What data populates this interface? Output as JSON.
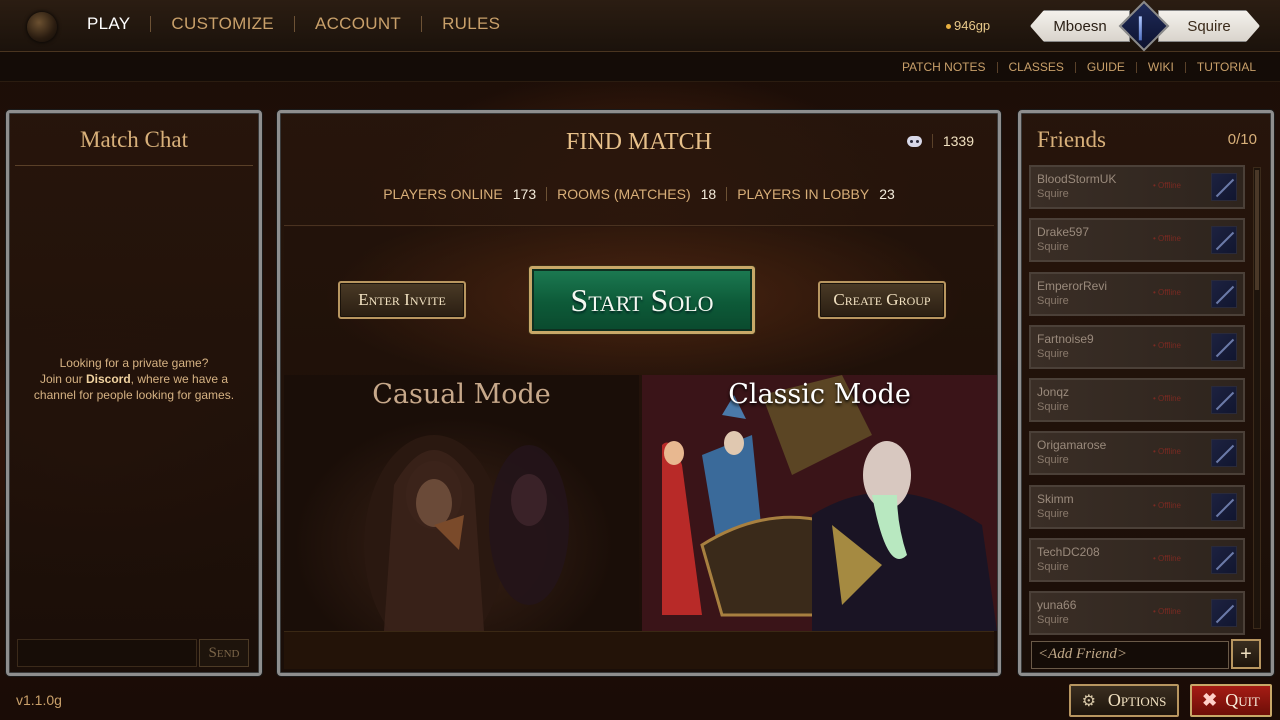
{
  "nav": {
    "items": [
      "PLAY",
      "CUSTOMIZE",
      "ACCOUNT",
      "RULES"
    ],
    "active": "PLAY"
  },
  "gold": "946gp",
  "profile": {
    "name": "Mboesn",
    "class": "Squire",
    "class_icon": "sword-icon"
  },
  "subnav": [
    "PATCH NOTES",
    "CLASSES",
    "GUIDE",
    "WIKI",
    "TUTORIAL"
  ],
  "chat": {
    "title": "Match Chat",
    "msg_line1": "Looking for a private game?",
    "msg_line2_pre": "Join our ",
    "msg_discord": "Discord",
    "msg_line2_post": ", where we have a",
    "msg_line3": "channel for people looking for games.",
    "input_value": "",
    "send_label": "Send"
  },
  "match": {
    "title": "FIND MATCH",
    "discord_count": "1339",
    "stats": [
      {
        "label": "PLAYERS ONLINE",
        "value": "173"
      },
      {
        "label": "ROOMS (MATCHES)",
        "value": "18"
      },
      {
        "label": "PLAYERS IN LOBBY",
        "value": "23"
      }
    ],
    "enter_invite": "Enter Invite",
    "start_solo": "Start Solo",
    "create_group": "Create Group",
    "casual_mode": "Casual Mode",
    "classic_mode": "Classic Mode"
  },
  "friends": {
    "title": "Friends",
    "count": "0/10",
    "list": [
      {
        "name": "BloodStormUK",
        "class": "Squire",
        "status": "Offline"
      },
      {
        "name": "Drake597",
        "class": "Squire",
        "status": "Offline"
      },
      {
        "name": "EmperorRevi",
        "class": "Squire",
        "status": "Offline"
      },
      {
        "name": "Fartnoise9",
        "class": "Squire",
        "status": "Offline"
      },
      {
        "name": "Jonqz",
        "class": "Squire",
        "status": "Offline"
      },
      {
        "name": "Origamarose",
        "class": "Squire",
        "status": "Offline"
      },
      {
        "name": "Skimm",
        "class": "Squire",
        "status": "Offline"
      },
      {
        "name": "TechDC208",
        "class": "Squire",
        "status": "Offline"
      },
      {
        "name": "yuna66",
        "class": "Squire",
        "status": "Offline"
      }
    ],
    "add_placeholder": "<Add Friend>",
    "add_button": "+"
  },
  "version": "v1.1.0g",
  "options_label": "Options",
  "quit_label": "Quit",
  "colors": {
    "accent_gold": "#d8b07a",
    "start_green": "#0d5a38",
    "quit_red": "#a51c14"
  }
}
